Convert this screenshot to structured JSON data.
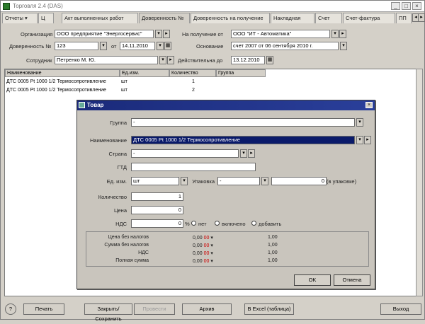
{
  "window": {
    "title": "Торговля 2.4 (DAS)"
  },
  "tabs": [
    {
      "label": "Отчеты ▾"
    },
    {
      "label": "Ц"
    },
    {
      "label": "Акт выполненных работ"
    },
    {
      "label": "Доверенность №"
    },
    {
      "label": "Доверенность на получение"
    },
    {
      "label": "Накладная"
    },
    {
      "label": "Счет"
    },
    {
      "label": "Счет-фактура"
    },
    {
      "label": "ПП"
    }
  ],
  "form": {
    "org_label": "Организация",
    "org_value": "ООО предприятие \"Энергосервис\"",
    "dov_label": "Доверенность №",
    "dov_value": "123",
    "from_label": "от",
    "from_value": "14.11.2010",
    "recv_label": "На получение от",
    "recv_value": "ООО \"ИТ - Автоматика\"",
    "basis_label": "Основание",
    "basis_value": "счет 2007 от 06 сентября 2010 г.",
    "emp_label": "Сотрудник",
    "emp_value": "Петренко М. Ю.",
    "valid_label": "Действительна до",
    "valid_value": "13.12.2010"
  },
  "grid": {
    "columns": [
      "Наименование",
      "Ед.изм.",
      "Количество",
      "Группа"
    ],
    "rows": [
      {
        "name": "ДТС 0005 Pt 1000 1/2 Термосопротивление",
        "unit": "шт",
        "qty": "1",
        "group": ""
      },
      {
        "name": "ДТС 0005 Pt 1000 1/2 Термосопротивление",
        "unit": "шт",
        "qty": "2",
        "group": ""
      }
    ]
  },
  "dialog": {
    "title": "Товар",
    "group_label": "Группа",
    "group_value": "-",
    "name_label": "Наименование",
    "name_value": "ДТС 0005 Pt 1000 1/2 Термосопротивление",
    "country_label": "Страна",
    "country_value": "-",
    "gtd_label": "ГТД",
    "gtd_value": "",
    "unit_label": "Ед. изм.",
    "unit_value": "шт",
    "pack_label": "Упаковка",
    "pack_value": "-",
    "pack_qty": "0",
    "pack_suffix": "(в упаковке)",
    "qty_label": "Количество",
    "qty_value": "1",
    "price_label": "Цена",
    "price_value": "0",
    "vat_label": "НДС",
    "vat_value": "0",
    "vat_pct": "%",
    "radio1": "нет",
    "radio2": "включено",
    "radio3": "добавить",
    "totals": [
      {
        "label": "Цена без налогов",
        "v1": "0,00",
        "v2": "00",
        "v3": "1,00"
      },
      {
        "label": "Сумма без налогов",
        "v1": "0,00",
        "v2": "00",
        "v3": "1,00"
      },
      {
        "label": "НДС",
        "v1": "0,00",
        "v2": "00",
        "v3": "1,00"
      },
      {
        "label": "Полная сумма",
        "v1": "0,00",
        "v2": "00",
        "v3": "1,00"
      }
    ],
    "ok_label": "OK",
    "cancel_label": "Отмена"
  },
  "bottom": {
    "help_label": "?",
    "print_label": "Печать",
    "save_label": "Закрыть/Сохранить",
    "disabled_label": "Провести",
    "action_label": "Архив",
    "excel_label": "В Excel (таблица)",
    "exit_label": "Выход"
  }
}
